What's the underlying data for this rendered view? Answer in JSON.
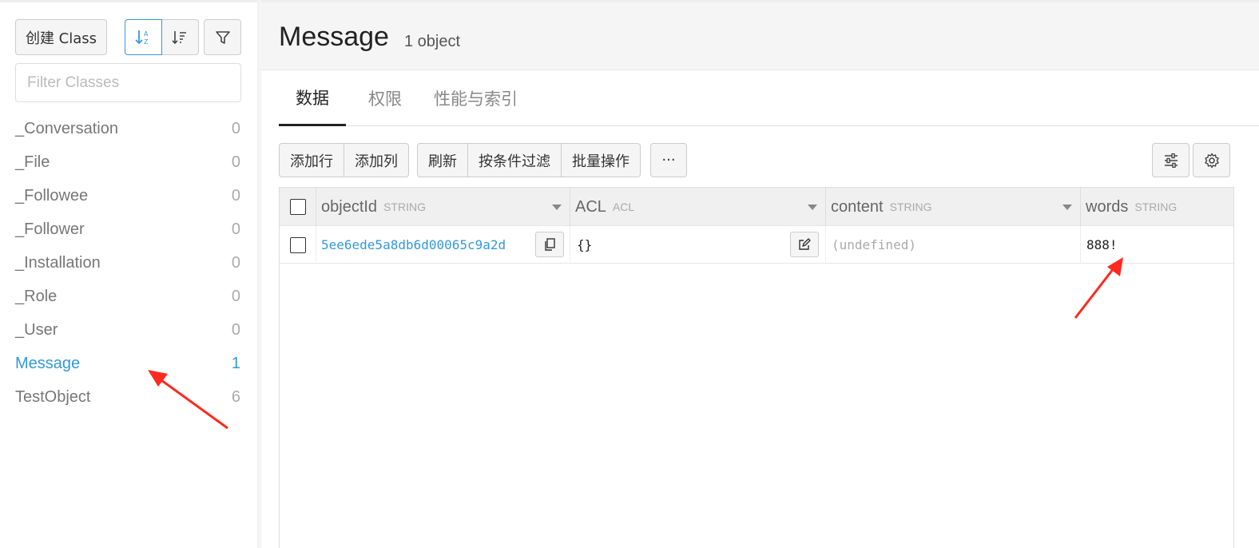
{
  "sidebar": {
    "create_class_label": "创建 Class",
    "filter_placeholder": "Filter Classes",
    "sort_asc_icon": "sort-alpha-asc-icon",
    "sort_desc_icon": "sort-amount-icon",
    "filter_icon": "funnel-icon",
    "classes": [
      {
        "name": "_Conversation",
        "count": "0"
      },
      {
        "name": "_File",
        "count": "0"
      },
      {
        "name": "_Followee",
        "count": "0"
      },
      {
        "name": "_Follower",
        "count": "0"
      },
      {
        "name": "_Installation",
        "count": "0"
      },
      {
        "name": "_Role",
        "count": "0"
      },
      {
        "name": "_User",
        "count": "0"
      },
      {
        "name": "Message",
        "count": "1"
      },
      {
        "name": "TestObject",
        "count": "6"
      }
    ],
    "active_class": "Message"
  },
  "header": {
    "title": "Message",
    "subtitle": "1 object"
  },
  "tabs": [
    {
      "label": "数据",
      "active": true
    },
    {
      "label": "权限",
      "active": false
    },
    {
      "label": "性能与索引",
      "active": false
    }
  ],
  "toolbar": {
    "add_row": "添加行",
    "add_column": "添加列",
    "refresh": "刷新",
    "filter": "按条件过滤",
    "batch": "批量操作",
    "more": "···",
    "columns_icon": "sliders-icon",
    "settings_icon": "gear-icon"
  },
  "grid": {
    "columns": [
      {
        "name": "objectId",
        "type": "STRING"
      },
      {
        "name": "ACL",
        "type": "ACL"
      },
      {
        "name": "content",
        "type": "STRING"
      },
      {
        "name": "words",
        "type": "STRING"
      }
    ],
    "rows": [
      {
        "objectId": "5ee6ede5a8db6d00065c9a2d",
        "ACL": "{}",
        "content": "(undefined)",
        "words": "888!"
      }
    ]
  },
  "colors": {
    "accent": "#3498db",
    "annotation_arrow": "#ff2a1f"
  }
}
